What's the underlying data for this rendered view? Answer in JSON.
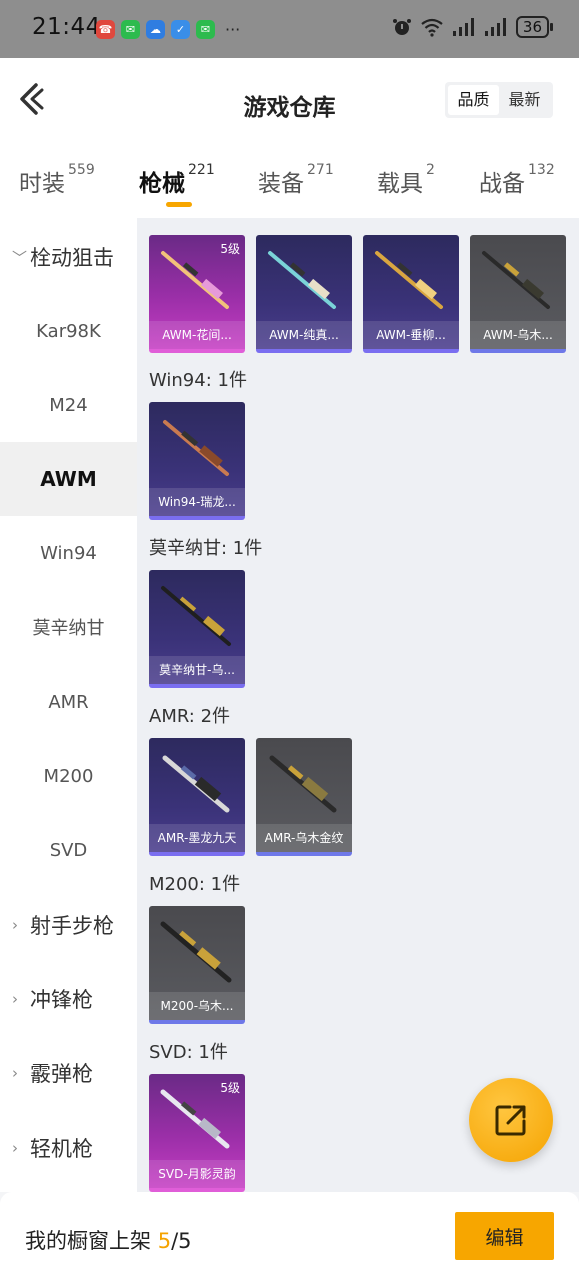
{
  "status_bar": {
    "time": "21:44",
    "more": "···",
    "battery": "36",
    "app_icons": [
      "red-app",
      "wechat-icon",
      "blue-app",
      "blue-app",
      "wechat-icon"
    ]
  },
  "header": {
    "title": "游戏仓库",
    "sort_options": [
      "品质",
      "最新"
    ],
    "active_sort": "品质"
  },
  "tabs": [
    {
      "label": "时装",
      "count": "559"
    },
    {
      "label": "枪械",
      "count": "221"
    },
    {
      "label": "装备",
      "count": "271"
    },
    {
      "label": "载具",
      "count": "2"
    },
    {
      "label": "战备",
      "count": "132"
    }
  ],
  "sidebar": {
    "items": [
      {
        "label": "栓动狙击",
        "type": "group",
        "expanded": true
      },
      {
        "label": "Kar98K",
        "type": "item"
      },
      {
        "label": "M24",
        "type": "item"
      },
      {
        "label": "AWM",
        "type": "item",
        "active": true
      },
      {
        "label": "Win94",
        "type": "item"
      },
      {
        "label": "莫辛纳甘",
        "type": "item"
      },
      {
        "label": "AMR",
        "type": "item"
      },
      {
        "label": "M200",
        "type": "item"
      },
      {
        "label": "SVD",
        "type": "item"
      },
      {
        "label": "射手步枪",
        "type": "group"
      },
      {
        "label": "冲锋枪",
        "type": "group"
      },
      {
        "label": "霰弹枪",
        "type": "group"
      },
      {
        "label": "轻机枪",
        "type": "group"
      }
    ]
  },
  "sections": [
    {
      "label": "",
      "cards": [
        {
          "name": "AWM-花间...",
          "level": "5级",
          "rarity": "pink"
        },
        {
          "name": "AWM-纯真...",
          "rarity": "purple"
        },
        {
          "name": "AWM-垂柳...",
          "rarity": "purple"
        },
        {
          "name": "AWM-乌木...",
          "rarity": "gray"
        }
      ]
    },
    {
      "label": "Win94: 1件",
      "cards": [
        {
          "name": "Win94-瑞龙...",
          "rarity": "purple"
        }
      ]
    },
    {
      "label": "莫辛纳甘: 1件",
      "cards": [
        {
          "name": "莫辛纳甘-乌...",
          "rarity": "purple"
        }
      ]
    },
    {
      "label": "AMR: 2件",
      "cards": [
        {
          "name": "AMR-墨龙九天",
          "rarity": "purple"
        },
        {
          "name": "AMR-乌木金纹",
          "rarity": "gray"
        }
      ]
    },
    {
      "label": "M200: 1件",
      "cards": [
        {
          "name": "M200-乌木...",
          "rarity": "gray"
        }
      ]
    },
    {
      "label": "SVD: 1件",
      "cards": [
        {
          "name": "SVD-月影灵韵",
          "level": "5级",
          "rarity": "pink"
        }
      ]
    }
  ],
  "bottom_bar": {
    "showcase_label": "我的橱窗上架",
    "showcase_current": "5",
    "showcase_sep": "/",
    "showcase_total": "5",
    "edit_label": "编辑"
  },
  "colors": {
    "accent": "#f7a600",
    "pink_rarity": "#c53ec3",
    "purple_rarity": "#4a3d8c",
    "gray_rarity": "#5a5b60"
  }
}
